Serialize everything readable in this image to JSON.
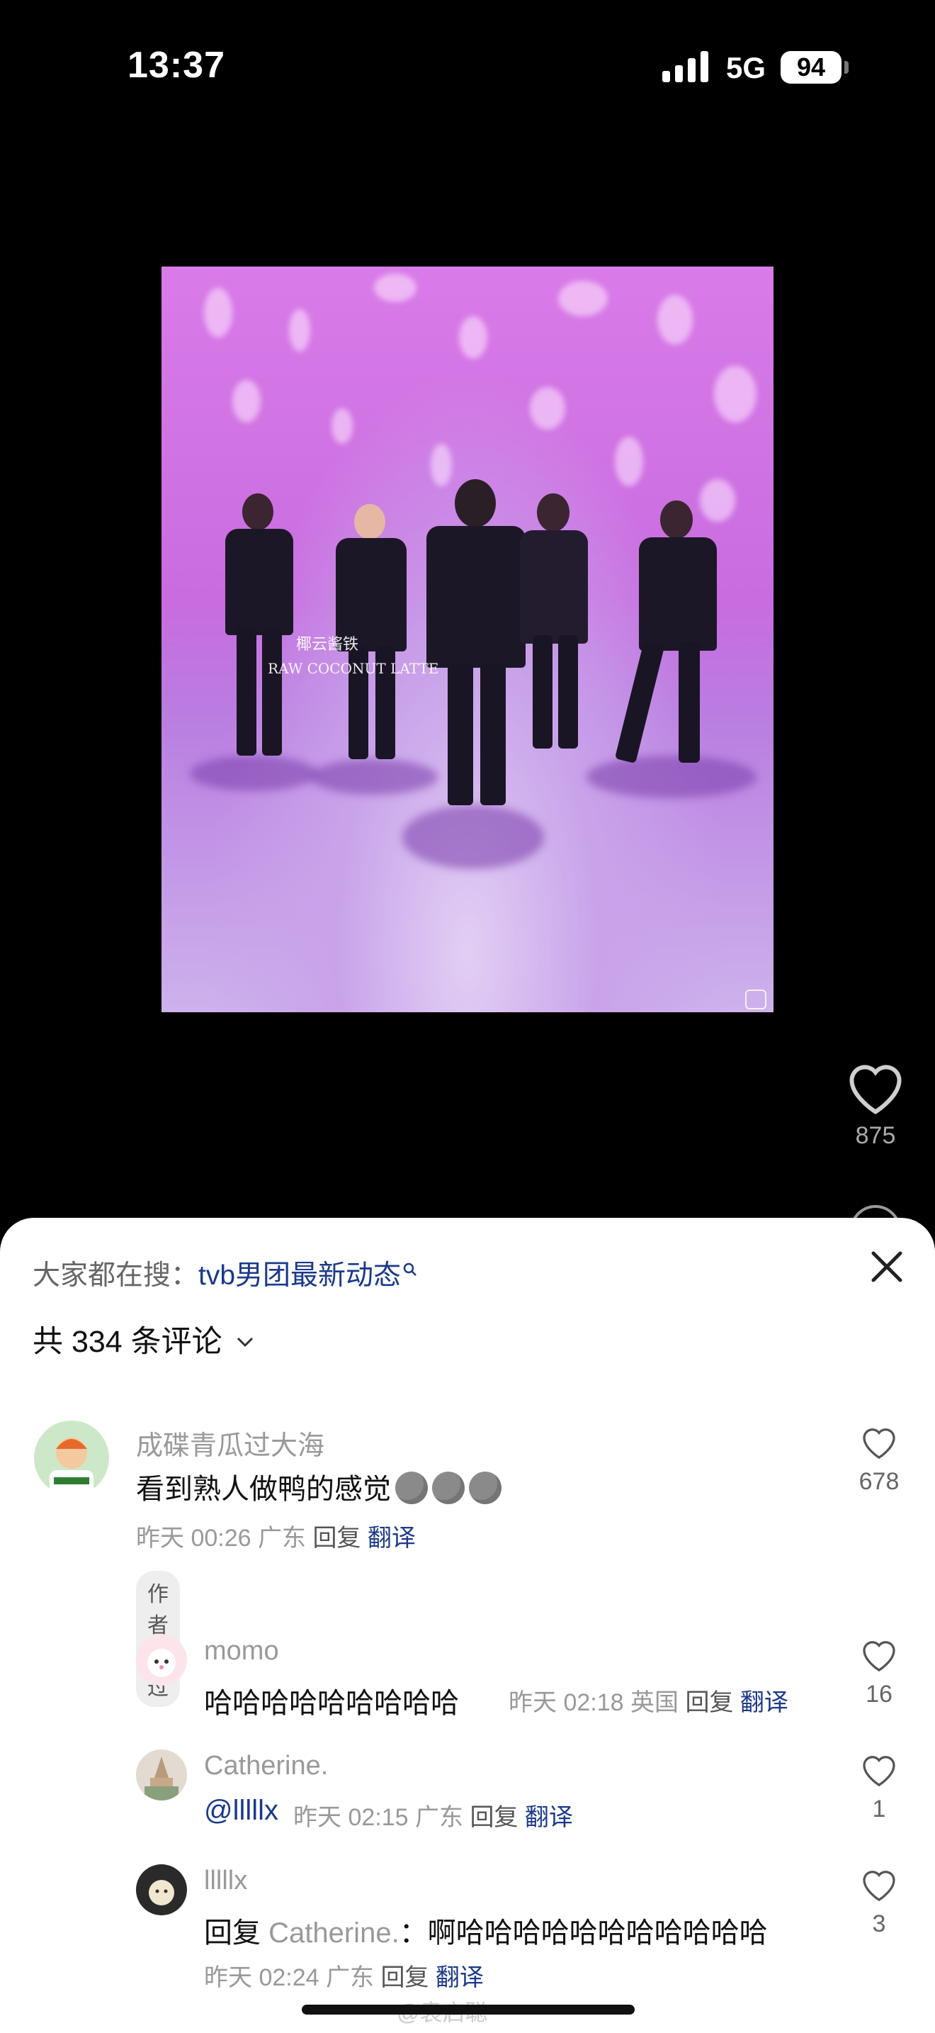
{
  "status_bar": {
    "time": "13:37",
    "network": "5G",
    "battery": "94"
  },
  "video": {
    "watermark_cn": "椰云酱铁",
    "watermark_en": "RAW COCONUT LATTE"
  },
  "side": {
    "like_count": "875"
  },
  "sheet": {
    "search_prefix": "大家都在搜：",
    "search_keyword": "tvb男团最新动态",
    "comment_count": "共 334 条评论",
    "comments": [
      {
        "user": "成碟青瓜过大海",
        "text": "看到熟人做鸭的感觉",
        "time": "昨天 00:26",
        "location": "广东",
        "reply": "回复",
        "translate": "翻译",
        "likes": "678",
        "badge": "作者赞过"
      },
      {
        "user": "momo",
        "text": "哈哈哈哈哈哈哈哈哈",
        "time": "昨天 02:18",
        "location": "英国",
        "reply": "回复",
        "translate": "翻译",
        "likes": "16"
      },
      {
        "user": "Catherine.",
        "text": "@lllllx",
        "time": "昨天 02:15",
        "location": "广东",
        "reply": "回复",
        "translate": "翻译",
        "likes": "1"
      },
      {
        "user": "lllllx",
        "reply_prefix": "回复",
        "reply_to": "Catherine.",
        "text": "：啊哈哈哈哈哈哈哈哈哈哈哈",
        "time": "昨天 02:24",
        "location": "广东",
        "reply": "回复",
        "translate": "翻译",
        "likes": "3"
      }
    ],
    "footer_watermark": "@袁启聪"
  }
}
